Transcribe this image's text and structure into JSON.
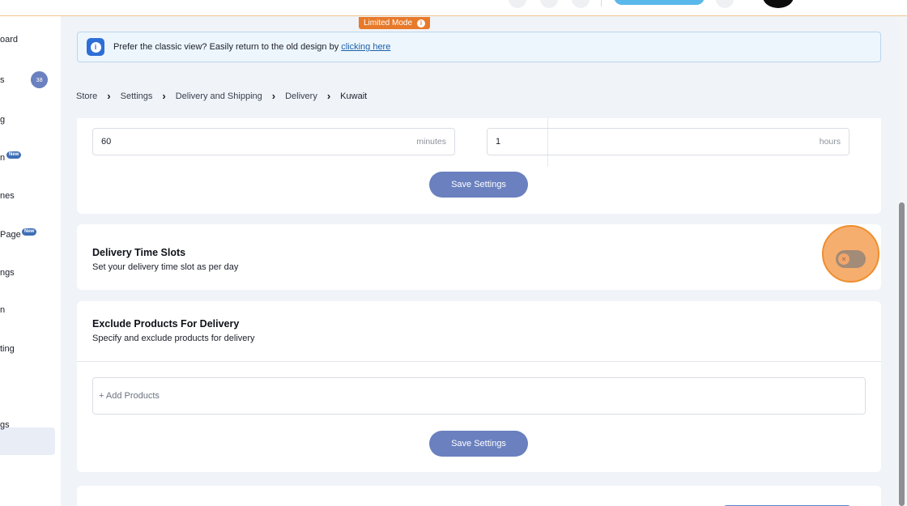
{
  "limited_mode": {
    "label": "Limited Mode",
    "info_icon": "i"
  },
  "banner": {
    "icon": "i",
    "text": "Prefer the classic view? Easily return to the old design by",
    "link": "clicking here"
  },
  "sidebar": {
    "items": [
      {
        "label": "oard"
      },
      {
        "label": "s",
        "badge": "38"
      },
      {
        "label": "g"
      },
      {
        "label": "n",
        "badge": "New"
      },
      {
        "label": "nes"
      },
      {
        "label": "Page",
        "badge": "New"
      },
      {
        "label": "ngs"
      },
      {
        "label": "n"
      },
      {
        "label": "ting"
      },
      {
        "label": "gs",
        "active": true
      }
    ]
  },
  "breadcrumb": [
    "Store",
    "Settings",
    "Delivery and Shipping",
    "Delivery",
    "Kuwait"
  ],
  "prep_section": {
    "field_left": {
      "value": "60",
      "unit": "minutes"
    },
    "field_right": {
      "value": "1",
      "unit": "hours"
    },
    "save_label": "Save Settings"
  },
  "time_slots": {
    "title": "Delivery Time Slots",
    "subtitle": "Set your delivery time slot as per day",
    "toggle_on": false,
    "toggle_glyph": "×"
  },
  "exclude_products": {
    "title": "Exclude Products For Delivery",
    "subtitle": "Specify and exclude products for delivery",
    "add_placeholder": "+ Add Products",
    "save_label": "Save Settings"
  },
  "colors": {
    "accent_button": "#6a80bf",
    "limited_mode": "#e7792a",
    "highlight": "#f6ae6e"
  }
}
